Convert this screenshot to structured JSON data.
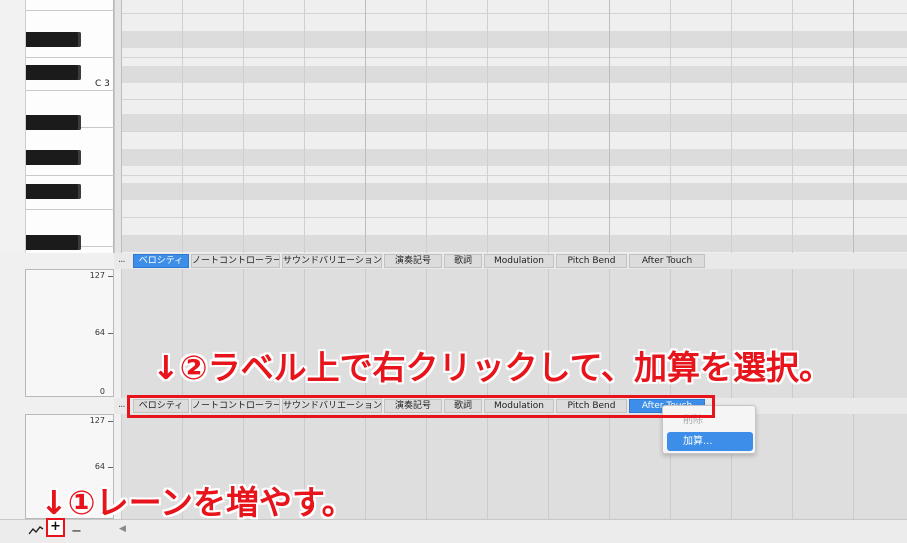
{
  "piano": {
    "octave_label": "C 3"
  },
  "tabs": [
    {
      "label": "ベロシティ"
    },
    {
      "label": "ノートコントローラー"
    },
    {
      "label": "サウンドバリエーション"
    },
    {
      "label": "演奏記号"
    },
    {
      "label": "歌詞"
    },
    {
      "label": "Modulation"
    },
    {
      "label": "Pitch Bend"
    },
    {
      "label": "After Touch"
    }
  ],
  "tabbar": {
    "overflow_label": "..."
  },
  "lane1": {
    "max": "127",
    "mid": "64",
    "min": "0",
    "selected_tab": "ベロシティ"
  },
  "lane2": {
    "max": "127",
    "mid": "64",
    "min": "0",
    "selected_tab": "After Touch"
  },
  "context_menu": {
    "items": [
      "削除",
      "加算..."
    ],
    "disabled_index": 0,
    "highlighted_index": 1
  },
  "bottom_controls": {
    "curve_icon": "line-curve-icon",
    "add_label": "+",
    "remove_label": "−",
    "scroll_left": "◀"
  },
  "annotations": {
    "step2": "↓②ラベル上で右クリックして、加算を選択。",
    "step1": "↓①レーンを増やす。"
  },
  "colors": {
    "accent": "#3d8ee8",
    "annotation_red": "#e8141c",
    "black_key": "#1b1b1b"
  }
}
